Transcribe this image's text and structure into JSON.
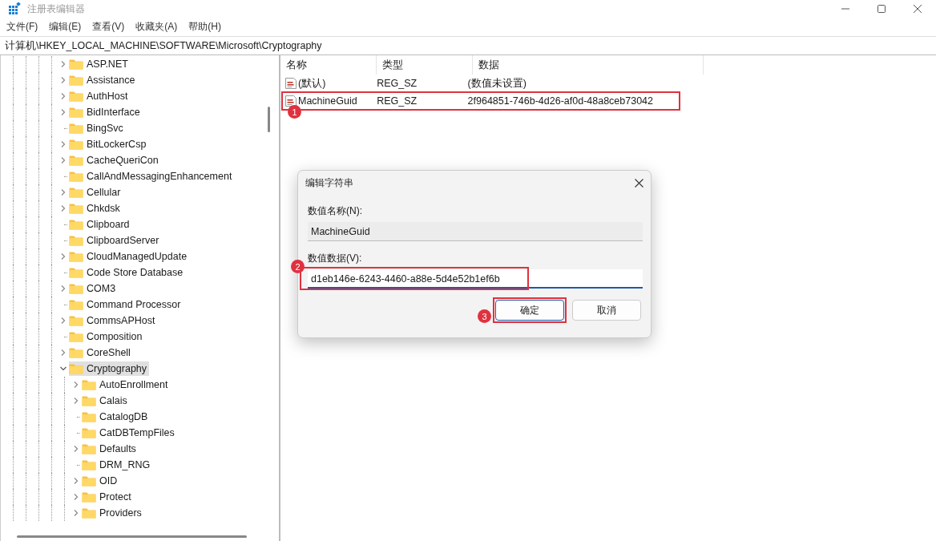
{
  "window": {
    "title": "注册表编辑器"
  },
  "menu": [
    {
      "label": "文件(F)"
    },
    {
      "label": "编辑(E)"
    },
    {
      "label": "查看(V)"
    },
    {
      "label": "收藏夹(A)"
    },
    {
      "label": "帮助(H)"
    }
  ],
  "address": "计算机\\HKEY_LOCAL_MACHINE\\SOFTWARE\\Microsoft\\Cryptography",
  "tree": [
    {
      "label": "ASP.NET",
      "has_children": true,
      "expanded": false,
      "selected": false
    },
    {
      "label": "Assistance",
      "has_children": true,
      "expanded": false,
      "selected": false
    },
    {
      "label": "AuthHost",
      "has_children": true,
      "expanded": false,
      "selected": false
    },
    {
      "label": "BidInterface",
      "has_children": true,
      "expanded": false,
      "selected": false
    },
    {
      "label": "BingSvc",
      "has_children": false,
      "expanded": false,
      "selected": false
    },
    {
      "label": "BitLockerCsp",
      "has_children": true,
      "expanded": false,
      "selected": false
    },
    {
      "label": "CacheQueriCon",
      "has_children": true,
      "expanded": false,
      "selected": false
    },
    {
      "label": "CallAndMessagingEnhancement",
      "has_children": false,
      "expanded": false,
      "selected": false
    },
    {
      "label": "Cellular",
      "has_children": true,
      "expanded": false,
      "selected": false
    },
    {
      "label": "Chkdsk",
      "has_children": true,
      "expanded": false,
      "selected": false
    },
    {
      "label": "Clipboard",
      "has_children": false,
      "expanded": false,
      "selected": false
    },
    {
      "label": "ClipboardServer",
      "has_children": false,
      "expanded": false,
      "selected": false
    },
    {
      "label": "CloudManagedUpdate",
      "has_children": true,
      "expanded": false,
      "selected": false
    },
    {
      "label": "Code Store Database",
      "has_children": false,
      "expanded": false,
      "selected": false
    },
    {
      "label": "COM3",
      "has_children": true,
      "expanded": false,
      "selected": false
    },
    {
      "label": "Command Processor",
      "has_children": false,
      "expanded": false,
      "selected": false
    },
    {
      "label": "CommsAPHost",
      "has_children": true,
      "expanded": false,
      "selected": false
    },
    {
      "label": "Composition",
      "has_children": false,
      "expanded": false,
      "selected": false
    },
    {
      "label": "CoreShell",
      "has_children": true,
      "expanded": false,
      "selected": false
    },
    {
      "label": "Cryptography",
      "has_children": true,
      "expanded": true,
      "selected": true,
      "children": [
        {
          "label": "AutoEnrollment",
          "has_children": true,
          "expanded": false,
          "selected": false
        },
        {
          "label": "Calais",
          "has_children": true,
          "expanded": false,
          "selected": false
        },
        {
          "label": "CatalogDB",
          "has_children": false,
          "expanded": false,
          "selected": false
        },
        {
          "label": "CatDBTempFiles",
          "has_children": false,
          "expanded": false,
          "selected": false
        },
        {
          "label": "Defaults",
          "has_children": true,
          "expanded": false,
          "selected": false
        },
        {
          "label": "DRM_RNG",
          "has_children": false,
          "expanded": false,
          "selected": false
        },
        {
          "label": "OID",
          "has_children": true,
          "expanded": false,
          "selected": false
        },
        {
          "label": "Protect",
          "has_children": true,
          "expanded": false,
          "selected": false
        },
        {
          "label": "Providers",
          "has_children": true,
          "expanded": false,
          "selected": false
        }
      ]
    }
  ],
  "values": {
    "columns": [
      "名称",
      "类型",
      "数据"
    ],
    "rows": [
      {
        "name": "(默认)",
        "type": "REG_SZ",
        "data": "(数值未设置)"
      },
      {
        "name": "MachineGuid",
        "type": "REG_SZ",
        "data": "2f964851-746b-4d26-af0d-48a8ceb73042",
        "annotation": "1"
      }
    ]
  },
  "dialog": {
    "title": "编辑字符串",
    "name_label": "数值名称(N):",
    "name_value": "MachineGuid",
    "data_label": "数值数据(V):",
    "data_value": "d1eb146e-6243-4460-a88e-5d4e52b1ef6b",
    "data_annotation": "2",
    "buttons": [
      {
        "label": "确定",
        "default": true,
        "annotation": "3"
      },
      {
        "label": "取消",
        "default": false
      }
    ]
  }
}
